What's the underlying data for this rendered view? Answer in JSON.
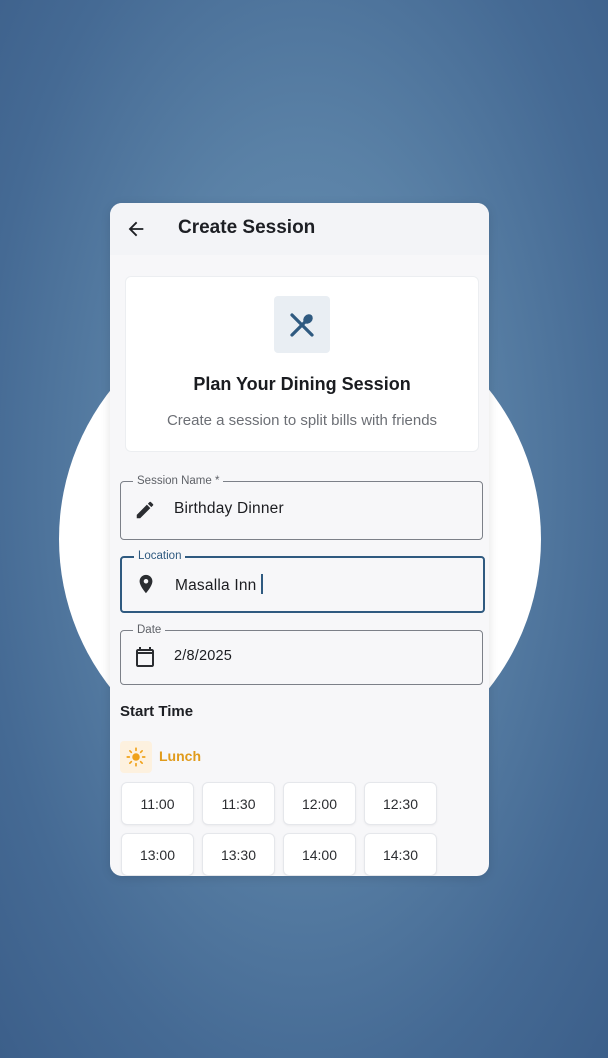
{
  "appbar": {
    "title": "Create Session",
    "back_icon": "arrow-left-icon"
  },
  "hero": {
    "icon": "utensils-icon",
    "title": "Plan Your Dining Session",
    "subtitle": "Create a session to split bills with friends"
  },
  "fields": {
    "session_name": {
      "label": "Session Name *",
      "value": "Birthday Dinner",
      "icon": "pencil-icon"
    },
    "location": {
      "label": "Location",
      "value": "Masalla Inn",
      "icon": "map-pin-icon"
    },
    "date": {
      "label": "Date",
      "value": "2/8/2025",
      "icon": "calendar-icon"
    }
  },
  "start_time": {
    "title": "Start Time",
    "period": {
      "label": "Lunch",
      "icon": "sun-icon",
      "color": "#E09B1C"
    },
    "slots": [
      "11:00",
      "11:30",
      "12:00",
      "12:30",
      "13:00",
      "13:30",
      "14:00",
      "14:30"
    ]
  },
  "colors": {
    "primary": "#2F5A80",
    "background": "#5A81A6",
    "accent_lunch": "#E09B1C"
  }
}
